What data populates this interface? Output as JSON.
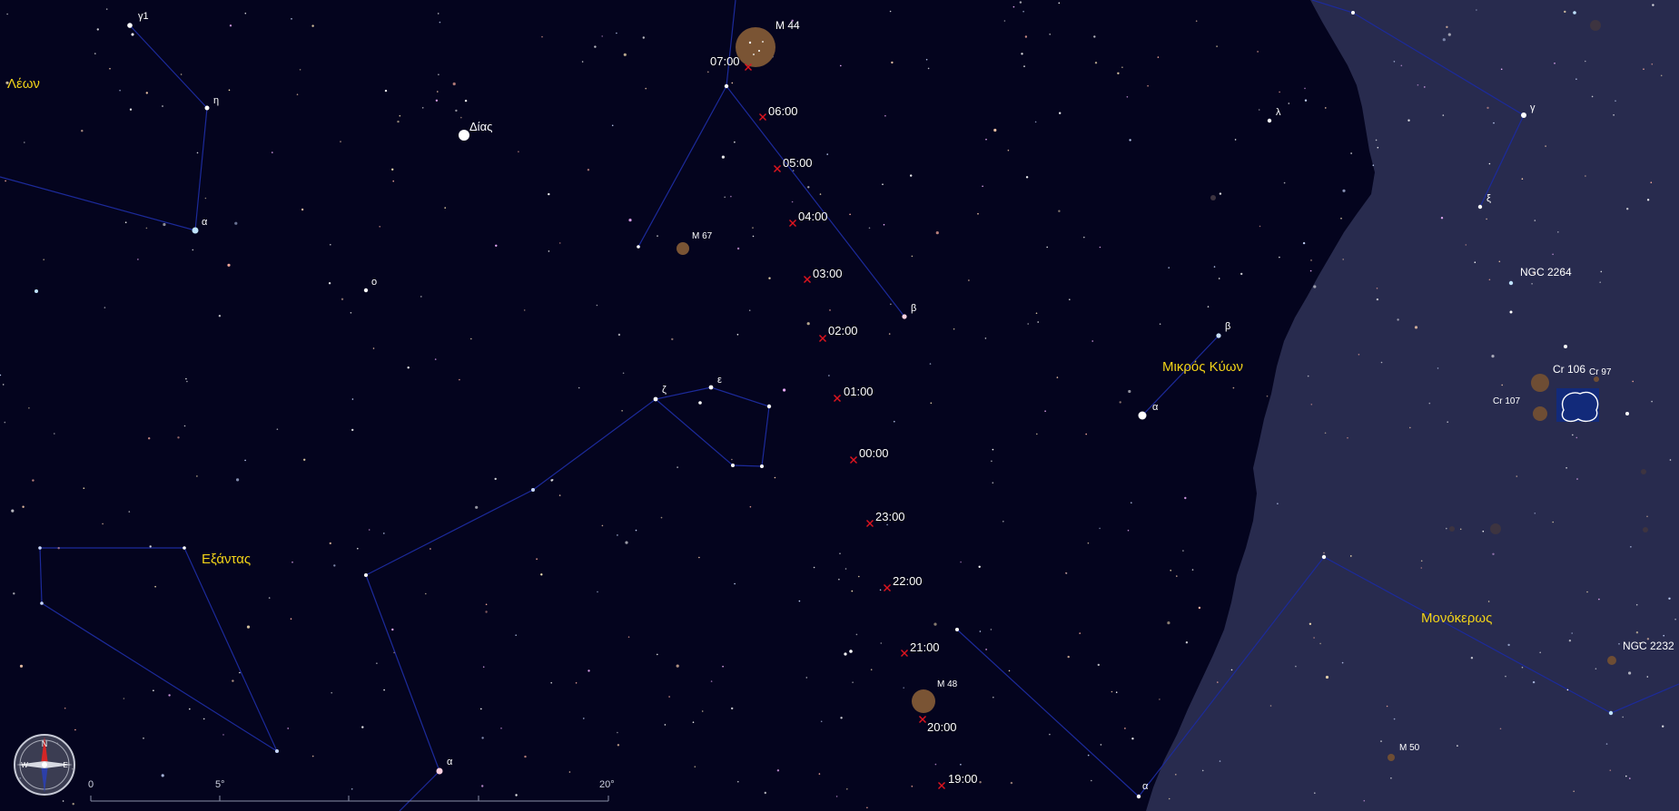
{
  "constellations": [
    {
      "id": "leo",
      "name": "Λέων"
    },
    {
      "id": "sextans",
      "name": "Εξάντας"
    },
    {
      "id": "canis-minor",
      "name": "Μικρός Κύων"
    },
    {
      "id": "monoceros",
      "name": "Μονόκερως"
    }
  ],
  "planets": [
    {
      "id": "jupiter",
      "name": "Δίας"
    }
  ],
  "star_labels": [
    "γ1",
    "η",
    "α",
    "ο",
    "ε",
    "ζ",
    "β",
    "α",
    "β",
    "α",
    "λ",
    "γ",
    "ξ",
    "α"
  ],
  "deep_sky_objects": [
    "M 44",
    "M 67",
    "M 48",
    "NGC 2264",
    "Cr 106",
    "Cr 97",
    "Cr 107",
    "NGC 2232",
    "M 50"
  ],
  "comet_track": {
    "times": [
      "07:00",
      "06:00",
      "05:00",
      "04:00",
      "03:00",
      "02:00",
      "01:00",
      "00:00",
      "23:00",
      "22:00",
      "21:00",
      "20:00",
      "19:00"
    ]
  },
  "scale_bar": {
    "ticks": [
      "0",
      "5°",
      "20°"
    ]
  },
  "compass": {
    "north": "N",
    "west": "W",
    "east": "E"
  },
  "colors": {
    "sky": "#04041e",
    "milky_way": "#282b4e",
    "constellation_line": "#1c2a9a",
    "constellation_label": "#f2d318",
    "track_marker": "#e0141e",
    "cluster": "#7a5434"
  }
}
